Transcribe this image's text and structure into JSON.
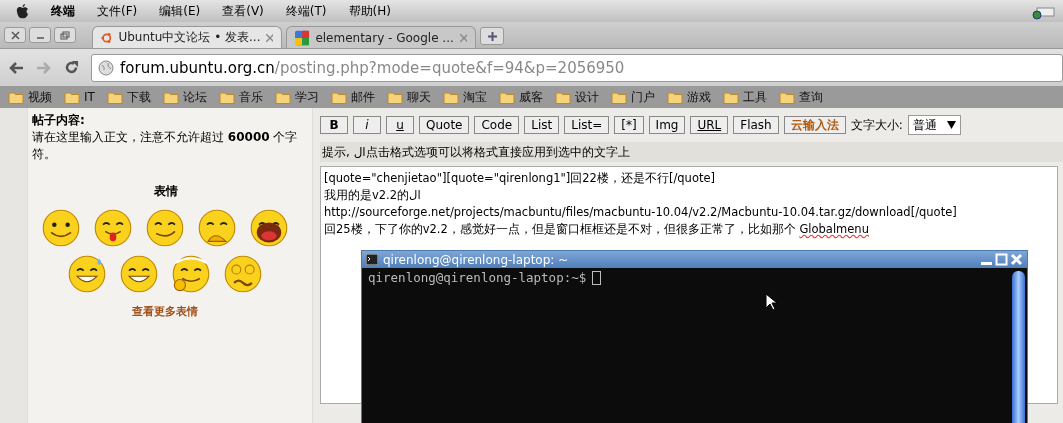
{
  "menubar": {
    "app": "终端",
    "items": [
      "文件(F)",
      "编辑(E)",
      "查看(V)",
      "终端(T)",
      "帮助(H)"
    ]
  },
  "tabs": [
    {
      "title": "Ubuntu中文论坛 • 发表...",
      "kind": "ubuntu",
      "selected": true
    },
    {
      "title": "elementary - Google ...",
      "kind": "google",
      "selected": false
    }
  ],
  "address": {
    "host": "forum.ubuntu.org.cn",
    "path": "/posting.php?mode=quote&f=94&p=2056950"
  },
  "bookmarks": [
    "视频",
    "IT",
    "下载",
    "论坛",
    "音乐",
    "学习",
    "邮件",
    "聊天",
    "淘宝",
    "威客",
    "设计",
    "门户",
    "游戏",
    "工具",
    "查询"
  ],
  "post": {
    "label": "帖子内容:",
    "instructions": "请在这里输入正文，注意不允许超过 **60000** 个字符。"
  },
  "smilies": {
    "title": "表情",
    "items": [
      {
        "kind": "smile"
      },
      {
        "kind": "tongue"
      },
      {
        "kind": "smirk"
      },
      {
        "kind": "giggle"
      },
      {
        "kind": "laugh"
      },
      {
        "kind": "sweat"
      },
      {
        "kind": "grin"
      },
      {
        "kind": "thumb"
      },
      {
        "kind": "dizzy"
      }
    ],
    "more": "查看更多表情"
  },
  "editor": {
    "buttons": [
      {
        "label": "B",
        "kind": "bold"
      },
      {
        "label": "i",
        "kind": "italic"
      },
      {
        "label": "u",
        "kind": "underline"
      },
      {
        "label": "Quote",
        "kind": "plain"
      },
      {
        "label": "Code",
        "kind": "plain"
      },
      {
        "label": "List",
        "kind": "plain"
      },
      {
        "label": "List=",
        "kind": "plain"
      },
      {
        "label": "[*]",
        "kind": "plain"
      },
      {
        "label": "Img",
        "kind": "plain"
      },
      {
        "label": "URL",
        "kind": "underline"
      },
      {
        "label": "Flash",
        "kind": "plain"
      },
      {
        "label": "云输入法",
        "kind": "accent"
      }
    ],
    "font_size": {
      "label": "文字大小:",
      "value": "普通"
    },
    "hint": "提示, ال点击格式选项可以将格式直接应用到选中的文字上",
    "lines": [
      {
        "text": "[quote=\"chenjietao\"][quote=\"qirenlong1\"]回22楼，还是不行[/quote]"
      },
      {
        "text": "我用的是v2.2的ال"
      },
      {
        "text": "http://sourceforge.net/projects/macbuntu/files/macbuntu-10.04/v2.2/Macbuntu-10.04.tar.gz/download[/quote]"
      },
      {
        "text": "回25楼，下了你的v2.2，感觉好一点，但是窗口框框还是不对，但很多正常了，比如那个 ",
        "misspelled": "Globalmenu"
      }
    ]
  },
  "terminal": {
    "title": "qirenlong@qirenlong-laptop: ~",
    "prompt": "qirenlong@qirenlong-laptop:~$"
  }
}
